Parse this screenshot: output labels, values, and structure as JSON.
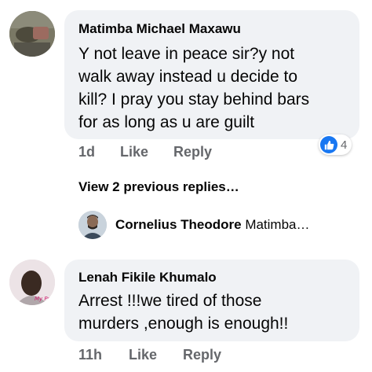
{
  "comments": [
    {
      "author": "Matimba Michael Maxawu",
      "text_lines": [
        "Y not leave in peace sir?y not",
        "walk away instead u decide to",
        "kill? I pray you stay behind bars",
        "for as long as u are guilt"
      ],
      "time": "1d",
      "like_label": "Like",
      "reply_label": "Reply",
      "reaction_count": "4",
      "reaction_icon": "thumbs-up-icon",
      "reaction_color": "#1877f2"
    },
    {
      "author": "Lenah Fikile Khumalo",
      "text_lines": [
        "Arrest !!!we tired of those",
        "murders ,enough is enough!!"
      ],
      "time": "11h",
      "like_label": "Like",
      "reply_label": "Reply"
    }
  ],
  "view_previous_replies": "View 2 previous replies…",
  "reply_preview": {
    "author": "Cornelius Theodore",
    "snippet": "Matimba…"
  },
  "colors": {
    "bubble_bg": "#f0f2f5",
    "meta_text": "#65676b",
    "like_blue": "#1877f2"
  }
}
